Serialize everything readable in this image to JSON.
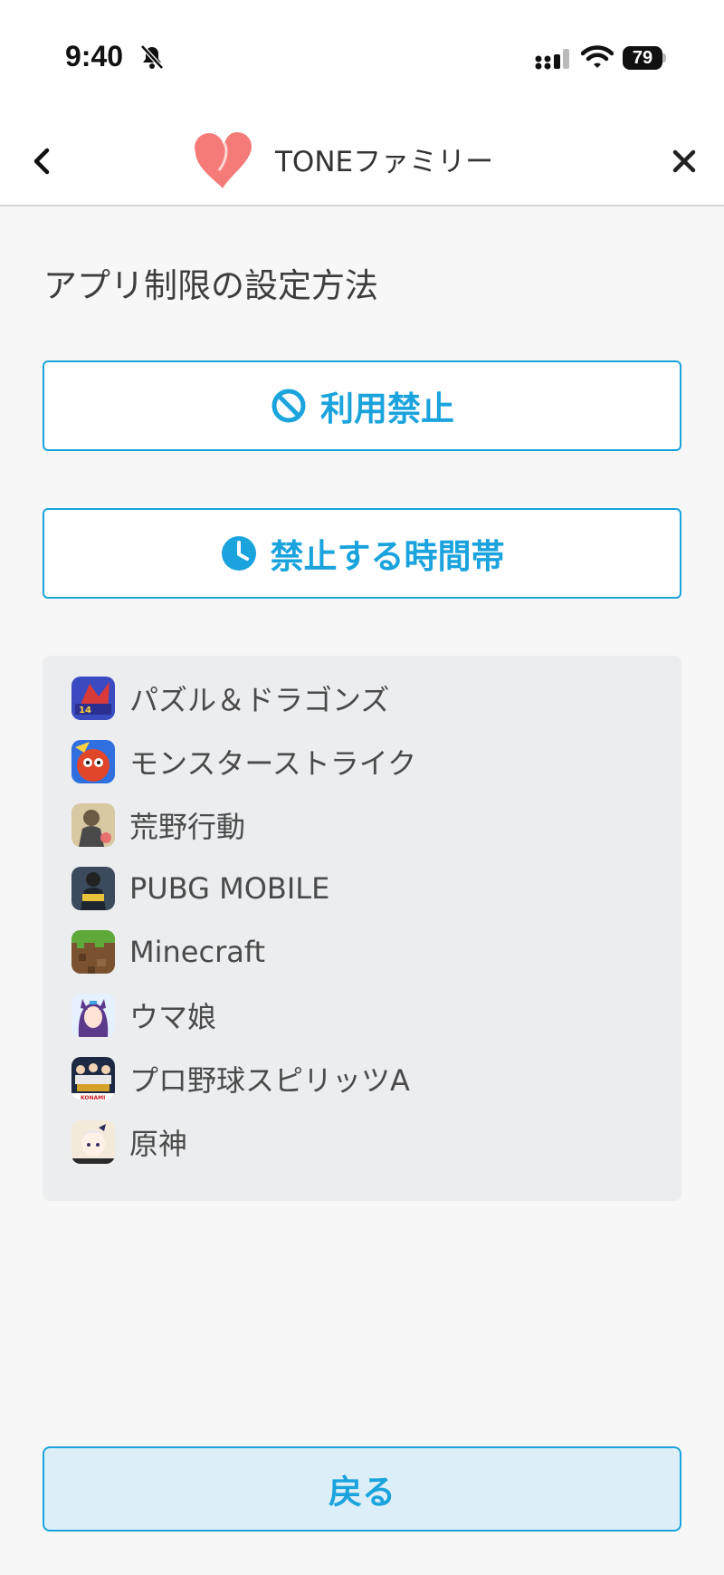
{
  "status": {
    "time": "9:40",
    "battery": "79"
  },
  "nav": {
    "title": "TONEファミリー"
  },
  "page": {
    "title": "アプリ制限の設定方法"
  },
  "buttons": {
    "prohibit_label": "利用禁止",
    "timeband_label": "禁止する時間帯",
    "back_label": "戻る"
  },
  "apps": [
    {
      "name": "パズル＆ドラゴンズ",
      "icon": "puzzle-dragons-icon"
    },
    {
      "name": "モンスターストライク",
      "icon": "monster-strike-icon"
    },
    {
      "name": "荒野行動",
      "icon": "knives-out-icon"
    },
    {
      "name": "PUBG MOBILE",
      "icon": "pubg-mobile-icon"
    },
    {
      "name": "Minecraft",
      "icon": "minecraft-icon"
    },
    {
      "name": "ウマ娘",
      "icon": "uma-musume-icon"
    },
    {
      "name": "プロ野球スピリッツA",
      "icon": "pro-yakyu-spirits-icon"
    },
    {
      "name": "原神",
      "icon": "genshin-icon"
    }
  ],
  "colors": {
    "accent": "#1aa3dd",
    "brand_heart": "#f47b78",
    "list_background": "#ebedef",
    "back_button_fill": "#dceff8"
  }
}
